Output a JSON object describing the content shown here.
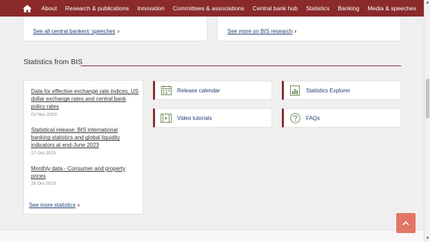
{
  "nav": {
    "items": [
      {
        "label": "About"
      },
      {
        "label": "Research & publications"
      },
      {
        "label": "Innovation"
      },
      {
        "label": "Committees & associations"
      },
      {
        "label": "Central bank hub"
      },
      {
        "label": "Statistics"
      },
      {
        "label": "Banking"
      },
      {
        "label": "Media & speeches"
      }
    ]
  },
  "top_cards": {
    "left_link": "See all central bankers' speeches",
    "right_link": "See more on BIS research"
  },
  "stats_section": {
    "title": "Statistics from BIS",
    "list": [
      {
        "title": "Data for effective exchange rate indices, US dollar exchange rates and central bank policy rates",
        "date": "02 Nov 2023"
      },
      {
        "title": "Statistical release: BIS international banking statistics and global liquidity indicators at end-June 2023",
        "date": "27 Oct 2023"
      },
      {
        "title": "Monthly data - Consumer and property prices",
        "date": "25 Oct 2023"
      }
    ],
    "see_more": "See more statistics",
    "tiles": [
      {
        "label": "Release calendar",
        "icon": "calendar-icon"
      },
      {
        "label": "Statistics Explorer",
        "icon": "chart-icon"
      },
      {
        "label": "Video tutorials",
        "icon": "video-icon"
      },
      {
        "label": "FAQs",
        "icon": "question-icon"
      }
    ]
  },
  "colors": {
    "brand": "#8a2a2b",
    "link": "#1f3f73",
    "back_to_top": "#e27565"
  }
}
